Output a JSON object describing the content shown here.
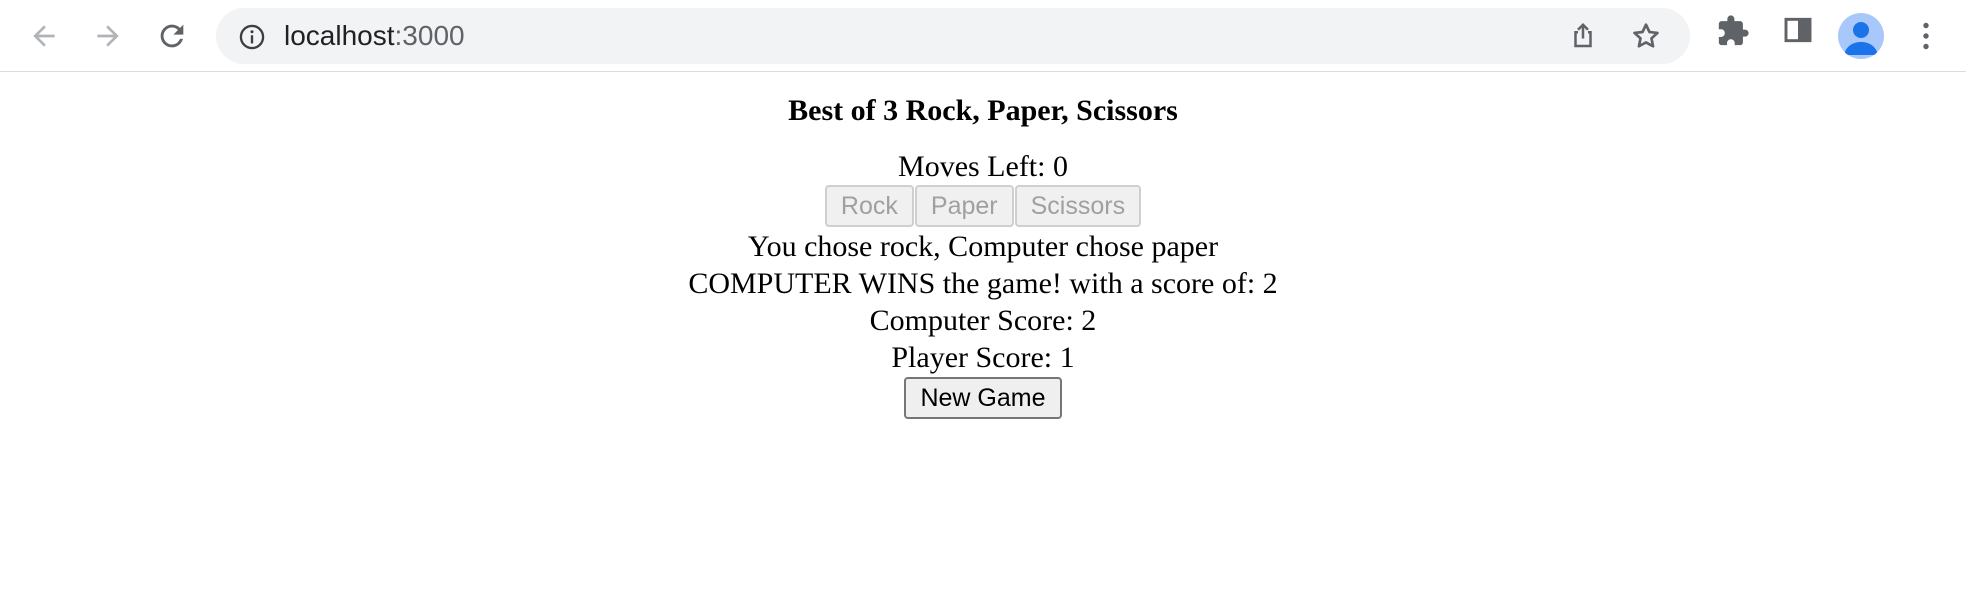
{
  "browser": {
    "url_host": "localhost",
    "url_port": ":3000",
    "icons": [
      "back-icon",
      "forward-icon",
      "reload-icon",
      "site-info-icon",
      "share-icon",
      "bookmark-star-icon",
      "extensions-icon",
      "side-panel-icon",
      "profile-avatar",
      "menu-icon"
    ]
  },
  "game": {
    "title": "Best of 3 Rock, Paper, Scissors",
    "moves_left": "Moves Left: 0",
    "choices": [
      "Rock",
      "Paper",
      "Scissors"
    ],
    "result_line": "You chose rock, Computer chose paper",
    "winner_line": "COMPUTER WINS the game! with a score of: 2",
    "computer_score": "Computer Score: 2",
    "player_score": "Player Score: 1",
    "new_game_label": "New Game"
  },
  "colors": {
    "omnibox_bg": "#f1f3f4",
    "disabled_text": "#a0a0a0",
    "avatar_bg": "#a8c7fa",
    "avatar_fg": "#1a73e8"
  }
}
